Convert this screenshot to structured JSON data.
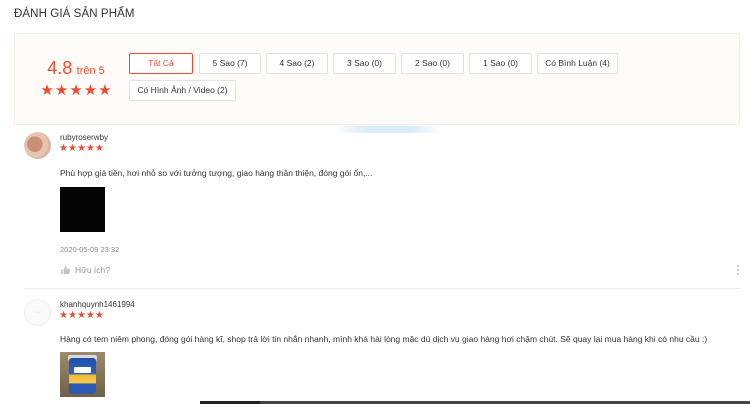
{
  "section": {
    "title": "ĐÁNH GIÁ SẢN PHẨM"
  },
  "overview": {
    "score": "4.8",
    "score_suffix": "trên 5",
    "stars": [
      "★",
      "★",
      "★",
      "★",
      "★"
    ],
    "rating": 4.8
  },
  "filters": [
    {
      "label": "Tất Cả",
      "active": true
    },
    {
      "label": "5 Sao (7)",
      "active": false
    },
    {
      "label": "4 Sao (2)",
      "active": false
    },
    {
      "label": "3 Sao (0)",
      "active": false
    },
    {
      "label": "2 Sao (0)",
      "active": false
    },
    {
      "label": "1 Sao (0)",
      "active": false
    },
    {
      "label": "Có Bình Luận (4)",
      "active": false
    },
    {
      "label": "Có Hình Ảnh / Video (2)",
      "active": false
    }
  ],
  "reviews": [
    {
      "username": "rubyroserwby",
      "stars": [
        "★",
        "★",
        "★",
        "★",
        "★"
      ],
      "comment": "Phù hợp giá tiền, hơi nhỏ so với tưởng tượng, giao hàng thân thiện, đóng gói ổn,...",
      "time": "2020-05-09 23:32",
      "helpful_label": "Hữu ích?"
    },
    {
      "username": "khanhquynh1461994",
      "avatar_text": "···",
      "stars": [
        "★",
        "★",
        "★",
        "★",
        "★"
      ],
      "comment": "Hàng có tem niêm phong, đóng gói hàng kĩ, shop trả lời tin nhắn nhanh, mình khá hài lòng mặc dù dịch vụ giao hàng hơi chậm chút. Sẽ quay lại mua hàng khi có nhu cầu :)"
    }
  ],
  "colors": {
    "accent": "#ee4d2d",
    "panel_bg": "#fffbf8",
    "muted": "#999999"
  }
}
